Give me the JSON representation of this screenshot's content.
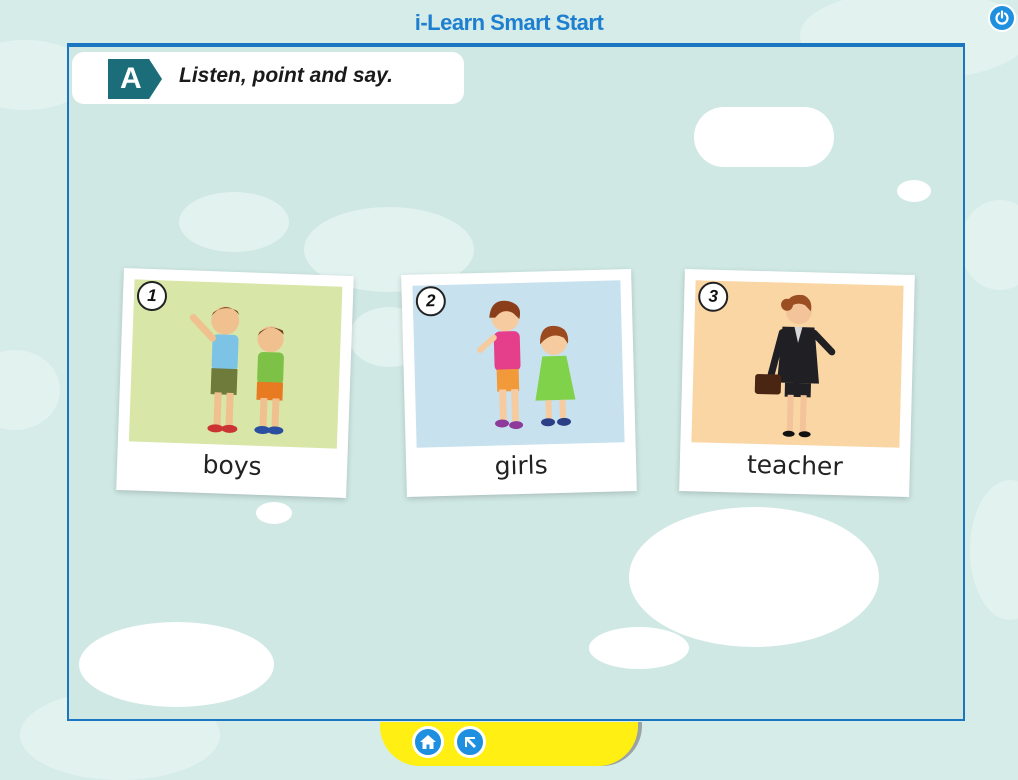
{
  "app": {
    "title": "i-Learn Smart Start"
  },
  "activity": {
    "badge": "A",
    "instruction": "Listen, point and say."
  },
  "cards": [
    {
      "number": "1",
      "word": "boys",
      "bg": "#d8e6a8"
    },
    {
      "number": "2",
      "word": "girls",
      "bg": "#c8e1ee"
    },
    {
      "number": "3",
      "word": "teacher",
      "bg": "#fad6a4"
    }
  ],
  "controls": {
    "power_icon": "power-icon",
    "home_icon": "home-icon",
    "back_icon": "arrow-back-icon"
  },
  "colors": {
    "accent": "#1f8fe0",
    "badge": "#1a6d79",
    "tab": "#ffef12",
    "sky": "#d6ece8"
  }
}
